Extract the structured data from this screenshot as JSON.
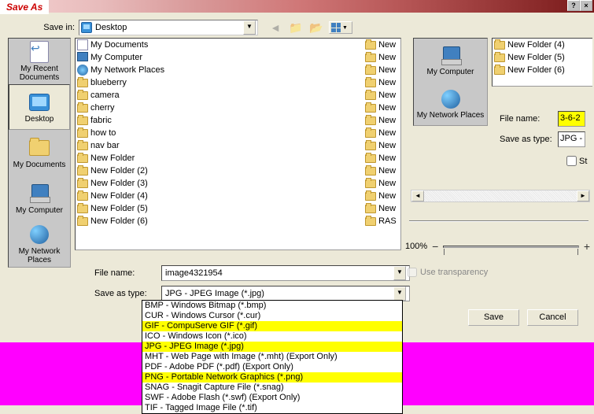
{
  "title": "Save As",
  "save_in_label": "Save in:",
  "save_in_value": "Desktop",
  "places": [
    {
      "label": "My Recent Documents"
    },
    {
      "label": "Desktop"
    },
    {
      "label": "My Documents"
    },
    {
      "label": "My Computer"
    },
    {
      "label": "My Network Places"
    }
  ],
  "file_items_col1": [
    {
      "label": "My Documents",
      "type": "docs"
    },
    {
      "label": "My Computer",
      "type": "comp"
    },
    {
      "label": "My Network Places",
      "type": "net"
    },
    {
      "label": "blueberry",
      "type": "folder"
    },
    {
      "label": "camera",
      "type": "folder"
    },
    {
      "label": "cherry",
      "type": "folder"
    },
    {
      "label": "fabric",
      "type": "folder"
    },
    {
      "label": "how to",
      "type": "folder"
    },
    {
      "label": "nav bar",
      "type": "folder"
    },
    {
      "label": "New Folder",
      "type": "folder"
    },
    {
      "label": "New Folder (2)",
      "type": "folder"
    },
    {
      "label": "New Folder (3)",
      "type": "folder"
    },
    {
      "label": "New Folder (4)",
      "type": "folder"
    },
    {
      "label": "New Folder (5)",
      "type": "folder"
    },
    {
      "label": "New Folder (6)",
      "type": "folder"
    }
  ],
  "file_items_col2": [
    {
      "label": "New",
      "type": "folder"
    },
    {
      "label": "New",
      "type": "folder"
    },
    {
      "label": "New",
      "type": "folder"
    },
    {
      "label": "New",
      "type": "folder"
    },
    {
      "label": "New",
      "type": "folder"
    },
    {
      "label": "New",
      "type": "folder"
    },
    {
      "label": "New",
      "type": "folder"
    },
    {
      "label": "New",
      "type": "folder"
    },
    {
      "label": "New",
      "type": "folder"
    },
    {
      "label": "New",
      "type": "folder"
    },
    {
      "label": "New",
      "type": "folder"
    },
    {
      "label": "New",
      "type": "folder"
    },
    {
      "label": "New",
      "type": "folder"
    },
    {
      "label": "New",
      "type": "folder"
    },
    {
      "label": "RAS",
      "type": "folder"
    }
  ],
  "file_name_label": "File name:",
  "file_name_value": "image4321954",
  "save_type_label": "Save as type:",
  "save_type_value": "JPG - JPEG Image (*.jpg)",
  "type_options": [
    {
      "label": "BMP - Windows Bitmap (*.bmp)",
      "hl": false
    },
    {
      "label": "CUR - Windows Cursor (*.cur)",
      "hl": false
    },
    {
      "label": "GIF - CompuServe GIF (*.gif)",
      "hl": true
    },
    {
      "label": "ICO - Windows Icon (*.ico)",
      "hl": false
    },
    {
      "label": "JPG - JPEG Image (*.jpg)",
      "hl": true
    },
    {
      "label": "MHT - Web Page with Image (*.mht) (Export Only)",
      "hl": false
    },
    {
      "label": "PDF - Adobe PDF (*.pdf) (Export Only)",
      "hl": false
    },
    {
      "label": "PNG - Portable Network Graphics (*.png)",
      "hl": true
    },
    {
      "label": "SNAG - Snagit Capture File (*.snag)",
      "hl": false
    },
    {
      "label": "SWF - Adobe Flash (*.swf) (Export Only)",
      "hl": false
    },
    {
      "label": "TIF - Tagged Image File (*.tif)",
      "hl": false
    }
  ],
  "use_transparency_label": "Use transparency",
  "save_btn": "Save",
  "cancel_btn": "Cancel",
  "sec_places": [
    {
      "label": "My Computer"
    },
    {
      "label": "My Network Places"
    }
  ],
  "sec_list": [
    {
      "label": "New Folder (4)"
    },
    {
      "label": "New Folder (5)"
    },
    {
      "label": "New Folder (6)"
    }
  ],
  "sec_file_name_label": "File name:",
  "sec_file_name_value": "3-6-2",
  "sec_type_label": "Save as type:",
  "sec_type_value": "JPG -",
  "sec_sh_label": "St",
  "zoom_label": "100%"
}
